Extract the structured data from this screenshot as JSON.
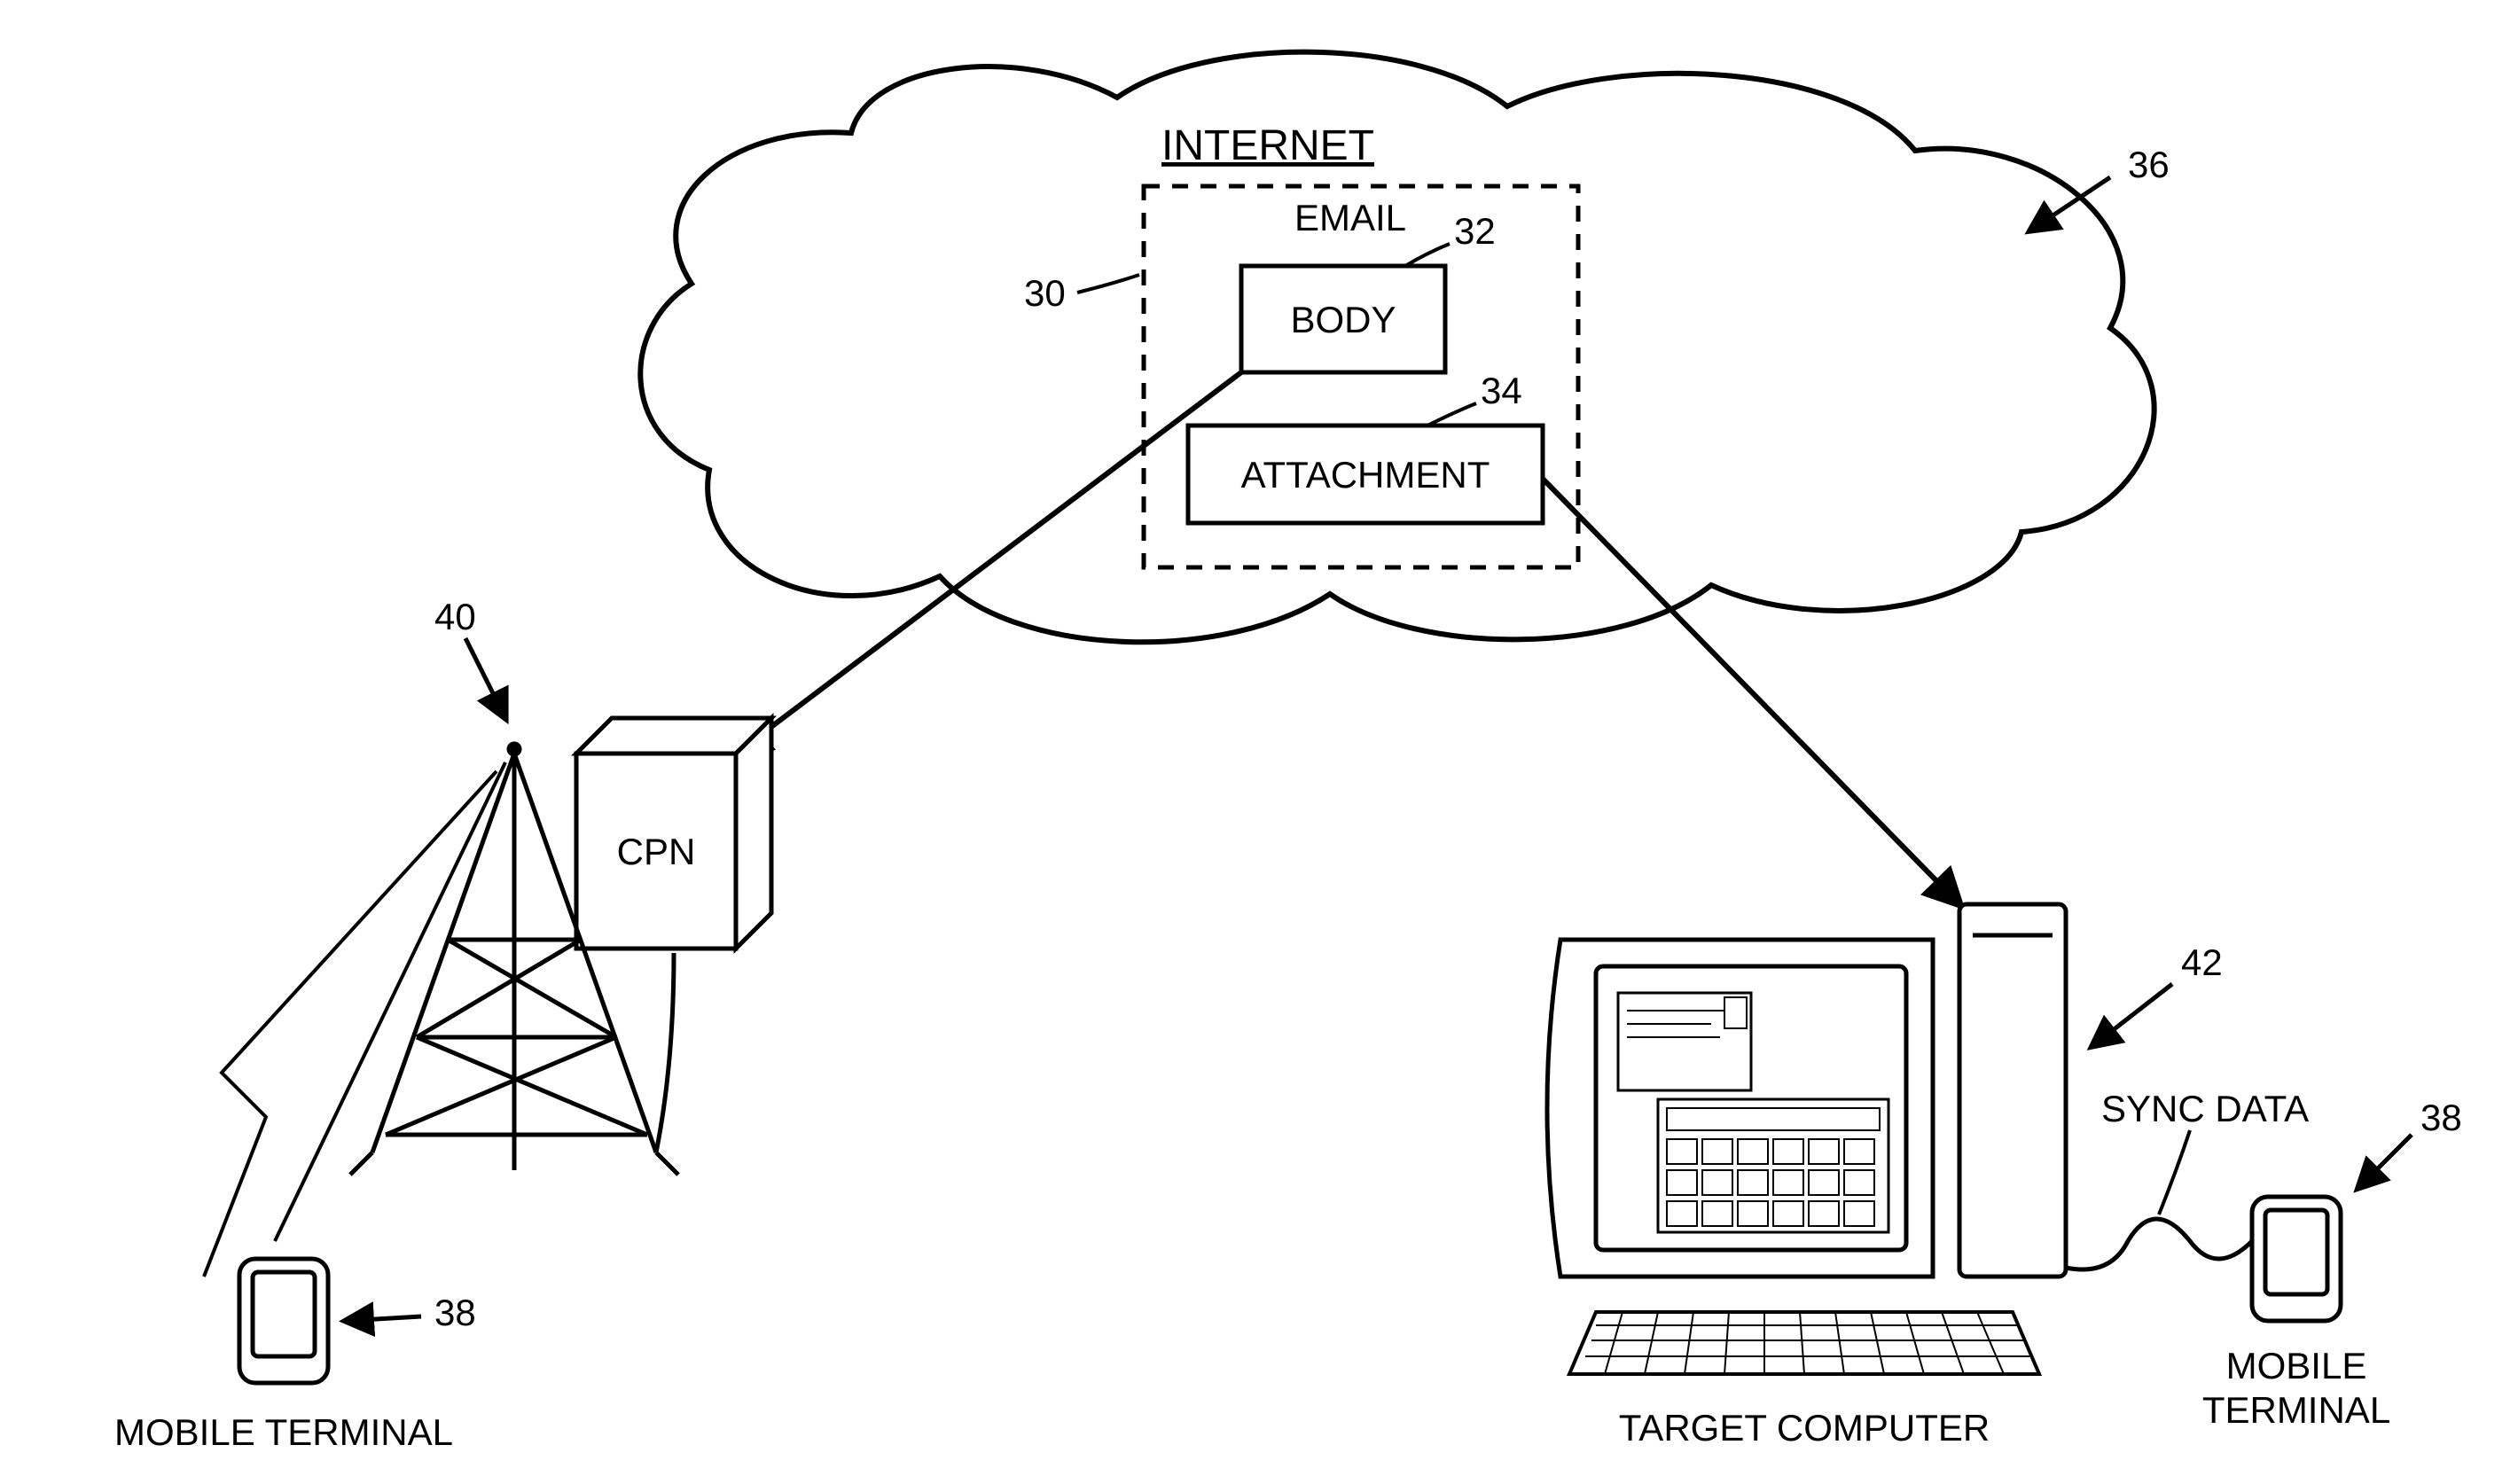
{
  "cloud": {
    "title": "INTERNET",
    "ref": "36"
  },
  "email": {
    "title": "EMAIL",
    "ref": "30",
    "body": {
      "label": "BODY",
      "ref": "32"
    },
    "attachment": {
      "label": "ATTACHMENT",
      "ref": "34"
    }
  },
  "cpn": {
    "label": "CPN",
    "ref": "40"
  },
  "mobile_left": {
    "label": "MOBILE TERMINAL",
    "ref": "38"
  },
  "mobile_right": {
    "label": "MOBILE TERMINAL",
    "ref": "38"
  },
  "target_computer": {
    "label": "TARGET COMPUTER",
    "ref": "42"
  },
  "sync": {
    "label": "SYNC DATA"
  }
}
